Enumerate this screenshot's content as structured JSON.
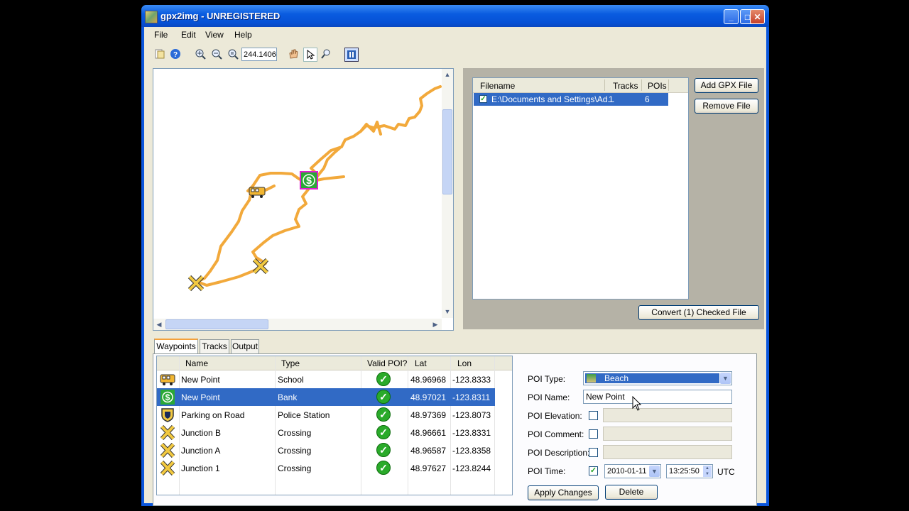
{
  "window": {
    "title": "gpx2img - UNREGISTERED",
    "minimize": "_",
    "maximize": "□",
    "close": "✕"
  },
  "menu": [
    "File",
    "Edit",
    "View",
    "Help"
  ],
  "toolbar": {
    "zoom_value": "244.1406"
  },
  "files": {
    "headers": [
      "Filename",
      "Tracks",
      "POIs"
    ],
    "rows": [
      {
        "checked": true,
        "filename": "E:\\Documents and Settings\\Ad...",
        "tracks": "1",
        "pois": "6"
      }
    ]
  },
  "buttons": {
    "add_gpx": "Add GPX File",
    "remove_file": "Remove File",
    "convert": "Convert (1) Checked File",
    "apply": "Apply Changes",
    "delete": "Delete"
  },
  "tabs": [
    "Waypoints",
    "Tracks",
    "Output"
  ],
  "waypoints": {
    "headers": [
      "Name",
      "Type",
      "Valid POI?",
      "Lat",
      "Lon"
    ],
    "rows": [
      {
        "icon": "school-bus-icon",
        "name": "New Point",
        "type": "School",
        "lat": "48.96968",
        "lon": "-123.8333"
      },
      {
        "icon": "bank-dollar-icon",
        "name": "New Point",
        "type": "Bank",
        "lat": "48.97021",
        "lon": "-123.8311",
        "selected": true
      },
      {
        "icon": "police-badge-icon",
        "name": "Parking on Road",
        "type": "Police Station",
        "lat": "48.97369",
        "lon": "-123.8073"
      },
      {
        "icon": "crossing-icon",
        "name": "Junction B",
        "type": "Crossing",
        "lat": "48.96661",
        "lon": "-123.8331"
      },
      {
        "icon": "crossing-icon",
        "name": "Junction A",
        "type": "Crossing",
        "lat": "48.96587",
        "lon": "-123.8358"
      },
      {
        "icon": "crossing-icon",
        "name": "Junction 1",
        "type": "Crossing",
        "lat": "48.97627",
        "lon": "-123.8244"
      }
    ]
  },
  "poi_form": {
    "type_label": "POI Type:",
    "type_value": "Beach",
    "name_label": "POI Name:",
    "name_value": "New Point",
    "elevation_label": "POI Elevation:",
    "comment_label": "POI Comment:",
    "description_label": "POI Description:",
    "time_label": "POI Time:",
    "date_value": "2010-01-11",
    "time_value": "13:25:50",
    "tz": "UTC"
  },
  "colors": {
    "track": "#f2a93b",
    "selection": "#316ac5",
    "highlight": "#e020d0"
  }
}
